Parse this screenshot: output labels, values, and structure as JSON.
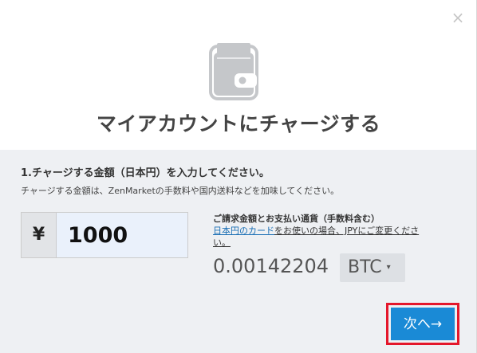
{
  "dialog": {
    "title": "マイアカウントにチャージする",
    "close_label": "×",
    "icon": "wallet-icon"
  },
  "form": {
    "step_label": "1.チャージする金額（日本円）を入力してください。",
    "hint": "チャージする金額は、ZenMarketの手数料や国内送料などを加味してください。",
    "currency_symbol": "¥",
    "amount_value": "1000"
  },
  "payment": {
    "title": "ご請求金額とお支払い通貨（手数料含む）",
    "note_link": "日本円のカード",
    "note_text": "をお使いの場合、JPYにご変更くださ",
    "note_text2": "い。",
    "converted_amount": "0.00142204",
    "selected_currency": "BTC",
    "caret": "▾"
  },
  "actions": {
    "next_label": "次へ→"
  },
  "colors": {
    "accent": "#1a8ad6",
    "highlight": "#e4172b",
    "panel_bg": "#eef0f3",
    "link": "#1a6fb5"
  }
}
